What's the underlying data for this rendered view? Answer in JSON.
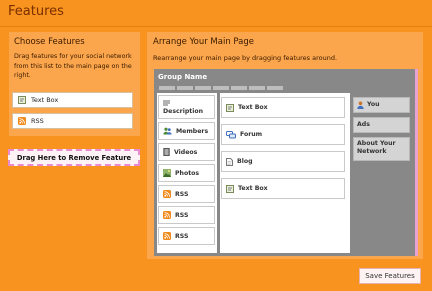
{
  "page": {
    "title": "Features"
  },
  "choose": {
    "title": "Choose Features",
    "description": "Drag features for your social network from this list to the main page on the right.",
    "items": [
      {
        "label": "Text Box",
        "icon": "text-box-icon"
      },
      {
        "label": "RSS",
        "icon": "rss-icon"
      }
    ],
    "drop_zone": "Drag Here to Remove Feature"
  },
  "arrange": {
    "title": "Arrange Your Main Page",
    "description": "Rearrange your main page by dragging features around.",
    "group_name": "Group Name",
    "left_column": [
      {
        "label": "Description",
        "icon": "description-icon"
      },
      {
        "label": "Members",
        "icon": "members-icon"
      },
      {
        "label": "Videos",
        "icon": "videos-icon"
      },
      {
        "label": "Photos",
        "icon": "photos-icon"
      },
      {
        "label": "RSS",
        "icon": "rss-icon"
      },
      {
        "label": "RSS",
        "icon": "rss-icon"
      },
      {
        "label": "RSS",
        "icon": "rss-icon"
      }
    ],
    "main_column": [
      {
        "label": "Text Box",
        "icon": "text-box-icon"
      },
      {
        "label": "Forum",
        "icon": "forum-icon"
      },
      {
        "label": "Blog",
        "icon": "blog-icon"
      },
      {
        "label": "Text Box",
        "icon": "text-box-icon"
      }
    ],
    "right_column": [
      {
        "label": "You",
        "icon": "user-icon"
      },
      {
        "label": "Ads",
        "icon": ""
      },
      {
        "label": "About Your Network",
        "icon": ""
      }
    ]
  },
  "save_button": "Save Features",
  "colors": {
    "background": "#f7931e",
    "panel": "#fba64c",
    "canvas": "#888888"
  }
}
